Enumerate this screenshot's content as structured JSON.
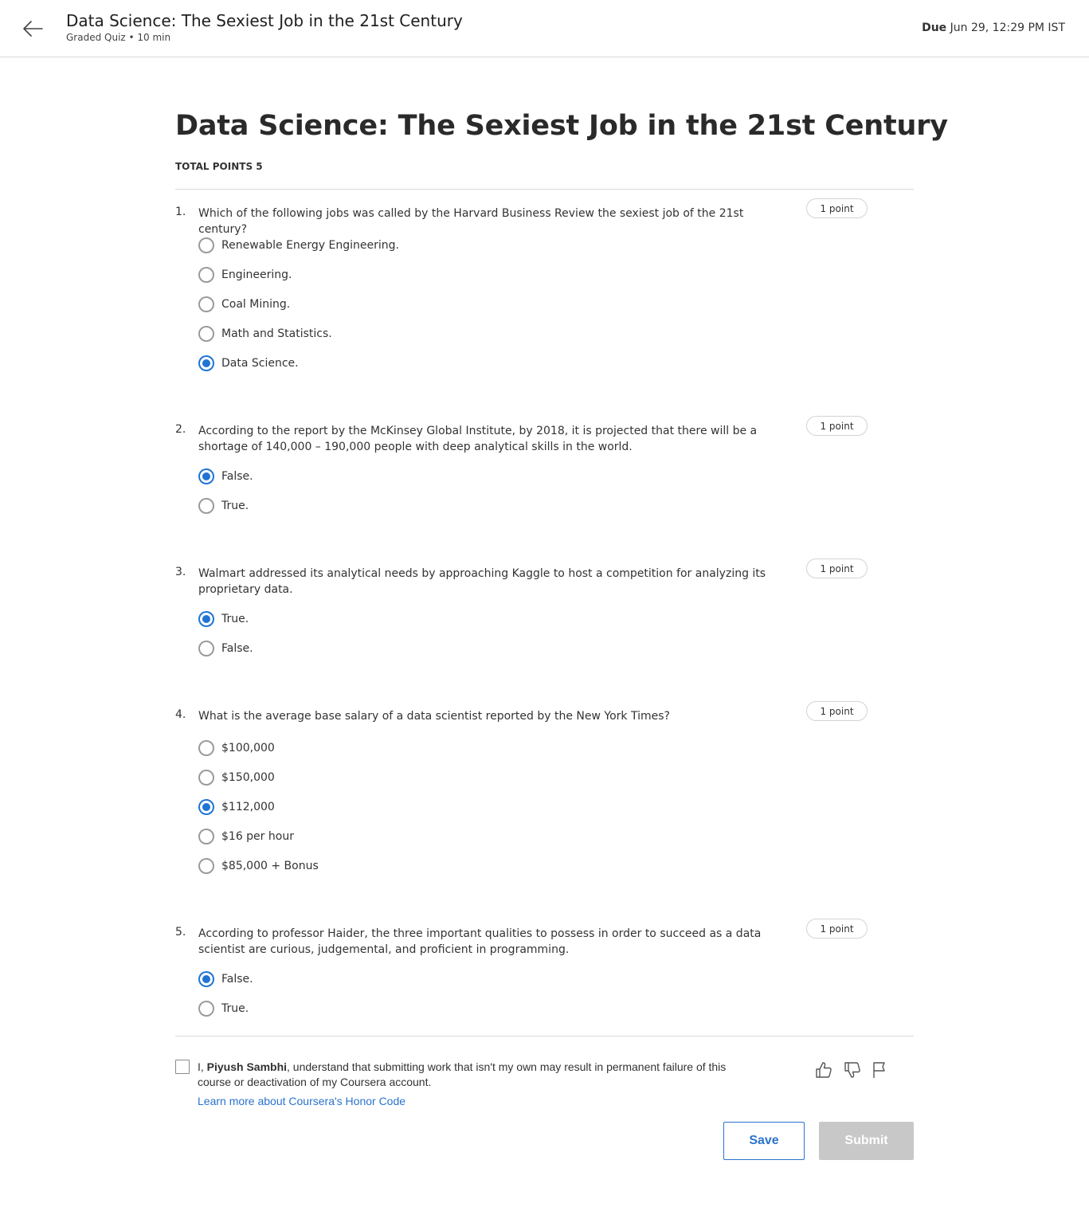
{
  "header": {
    "title": "Data Science: The Sexiest Job in the 21st Century",
    "subtitle": "Graded Quiz • 10 min",
    "due_label": "Due",
    "due_value": "Jun 29, 12:29 PM IST"
  },
  "quiz": {
    "title": "Data Science: The Sexiest Job in the 21st Century",
    "total_points": "TOTAL POINTS 5",
    "questions": [
      {
        "number": "1.",
        "text": "Which of the following jobs was called by the Harvard Business Review the sexiest job of the 21st century?",
        "points": "1 point",
        "options": [
          {
            "label": "Renewable Energy Engineering.",
            "selected": false
          },
          {
            "label": "Engineering.",
            "selected": false
          },
          {
            "label": "Coal Mining.",
            "selected": false
          },
          {
            "label": "Math and Statistics.",
            "selected": false
          },
          {
            "label": "Data Science.",
            "selected": true
          }
        ]
      },
      {
        "number": "2.",
        "text": "According to the report by the McKinsey Global Institute, by 2018, it is projected that there will be a shortage of 140,000 – 190,000 people with deep analytical skills in the world.",
        "points": "1 point",
        "options": [
          {
            "label": "False.",
            "selected": true
          },
          {
            "label": "True.",
            "selected": false
          }
        ]
      },
      {
        "number": "3.",
        "text": "Walmart addressed its analytical needs by approaching Kaggle to host a competition for analyzing its proprietary data.",
        "points": "1 point",
        "options": [
          {
            "label": "True.",
            "selected": true
          },
          {
            "label": "False.",
            "selected": false
          }
        ]
      },
      {
        "number": "4.",
        "text": "What is the average base salary of a data scientist reported by the New York Times?",
        "points": "1 point",
        "options": [
          {
            "label": "$100,000",
            "selected": false
          },
          {
            "label": "$150,000",
            "selected": false
          },
          {
            "label": "$112,000",
            "selected": true
          },
          {
            "label": "$16 per hour",
            "selected": false
          },
          {
            "label": "$85,000 + Bonus",
            "selected": false
          }
        ]
      },
      {
        "number": "5.",
        "text": "According to professor Haider, the three important qualities to possess in order to succeed as a data scientist are curious, judgemental, and proficient in programming.",
        "points": "1 point",
        "options": [
          {
            "label": "False.",
            "selected": true
          },
          {
            "label": "True.",
            "selected": false
          }
        ]
      }
    ]
  },
  "honor_code": {
    "prefix": "I, ",
    "name": "Piyush Sambhi",
    "statement": ", understand that submitting work that isn't my own may result in permanent failure of this course or deactivation of my Coursera account.",
    "link": "Learn more about Coursera's Honor Code",
    "checked": false
  },
  "feedback_icons": [
    "thumbs-up-icon",
    "thumbs-down-icon",
    "flag-icon"
  ],
  "actions": {
    "save_label": "Save",
    "submit_label": "Submit"
  },
  "colors": {
    "accent": "#1f74d4",
    "link": "#2a73cc",
    "submit_disabled": "#c8c8c8"
  }
}
